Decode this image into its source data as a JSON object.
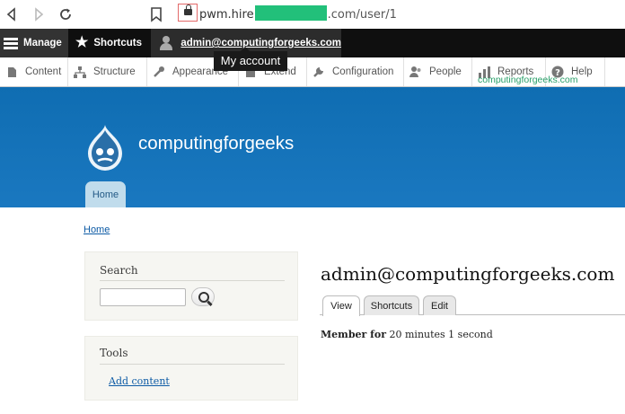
{
  "browser": {
    "url_prefix": "pwm.hire",
    "url_suffix": ".com/user/1"
  },
  "toolbar": {
    "manage": "Manage",
    "shortcuts": "Shortcuts",
    "user": "admin@computingforgeeks.com",
    "tooltip": "My account"
  },
  "tray": {
    "items": [
      {
        "label": "Content",
        "icon": "document-icon"
      },
      {
        "label": "Structure",
        "icon": "sitemap-icon"
      },
      {
        "label": "Appearance",
        "icon": "wrench-brush-icon"
      },
      {
        "label": "Extend",
        "icon": "puzzle-icon"
      },
      {
        "label": "Configuration",
        "icon": "wrench-icon"
      },
      {
        "label": "People",
        "icon": "people-icon"
      },
      {
        "label": "Reports",
        "icon": "bar-chart-icon"
      },
      {
        "label": "Help",
        "icon": "help-icon"
      }
    ],
    "watermark": "computingforgeeks.com"
  },
  "header": {
    "site_name": "computingforgeeks",
    "home_tab": "Home"
  },
  "breadcrumb": "Home",
  "sidebar": {
    "search": {
      "title": "Search"
    },
    "tools": {
      "title": "Tools",
      "link": "Add content"
    }
  },
  "main": {
    "title": "admin@computingforgeeks.com",
    "tabs": [
      "View",
      "Shortcuts",
      "Edit"
    ],
    "member_label": "Member for",
    "member_value": " 20 minutes 1 second"
  },
  "colors": {
    "header_blue": "#0f6db2",
    "toolbar_black": "#0f0f0f",
    "link_blue": "#0c5aa5",
    "redaction_green": "#22c07a"
  }
}
